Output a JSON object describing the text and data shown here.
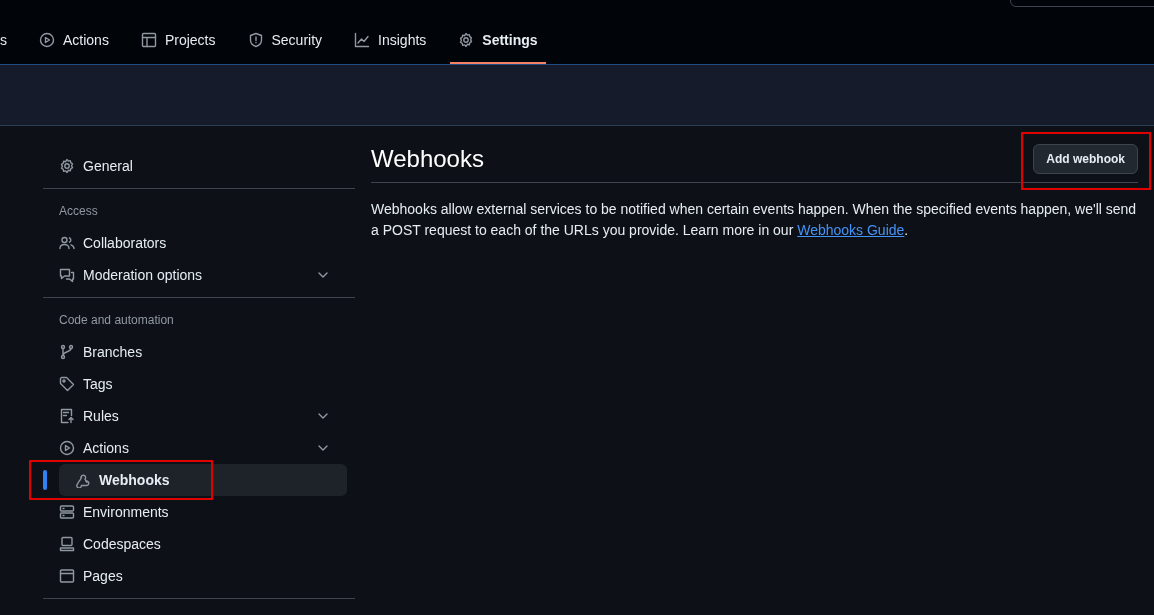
{
  "header": {
    "tabs": [
      {
        "label": "s",
        "selected": false
      },
      {
        "label": "Actions",
        "kind": "play",
        "selected": false
      },
      {
        "label": "Projects",
        "kind": "table",
        "selected": false
      },
      {
        "label": "Security",
        "kind": "shield",
        "selected": false
      },
      {
        "label": "Insights",
        "kind": "graph",
        "selected": false
      },
      {
        "label": "Settings",
        "kind": "gear",
        "selected": true
      }
    ]
  },
  "sidebar": {
    "sections": [
      {
        "items": [
          {
            "label": "General",
            "kind": "gear",
            "selected": false,
            "expandable": false,
            "annotated": false
          }
        ]
      },
      {
        "heading": "Access",
        "items": [
          {
            "label": "Collaborators",
            "kind": "people",
            "selected": false,
            "expandable": false,
            "annotated": false
          },
          {
            "label": "Moderation options",
            "kind": "comment",
            "selected": false,
            "expandable": true,
            "annotated": false
          }
        ]
      },
      {
        "heading": "Code and automation",
        "items": [
          {
            "label": "Branches",
            "kind": "branch",
            "selected": false,
            "expandable": false,
            "annotated": false
          },
          {
            "label": "Tags",
            "kind": "tag",
            "selected": false,
            "expandable": false,
            "annotated": false
          },
          {
            "label": "Rules",
            "kind": "rules",
            "selected": false,
            "expandable": true,
            "annotated": false
          },
          {
            "label": "Actions",
            "kind": "play",
            "selected": false,
            "expandable": true,
            "annotated": false
          },
          {
            "label": "Webhooks",
            "kind": "webhook",
            "selected": true,
            "expandable": false,
            "annotated": true
          },
          {
            "label": "Environments",
            "kind": "server",
            "selected": false,
            "expandable": false,
            "annotated": false
          },
          {
            "label": "Codespaces",
            "kind": "laptop",
            "selected": false,
            "expandable": false,
            "annotated": false
          },
          {
            "label": "Pages",
            "kind": "browser",
            "selected": false,
            "expandable": false,
            "annotated": false
          }
        ]
      }
    ]
  },
  "content": {
    "title": "Webhooks",
    "add_button": {
      "label": "Add webhook",
      "annotated": true
    },
    "description": {
      "text": "Webhooks allow external services to be notified when certain events happen. When the specified events happen, we'll send a POST request to each of the URLs you provide. Learn more in our ",
      "link": "Webhooks Guide",
      "after": "."
    }
  }
}
